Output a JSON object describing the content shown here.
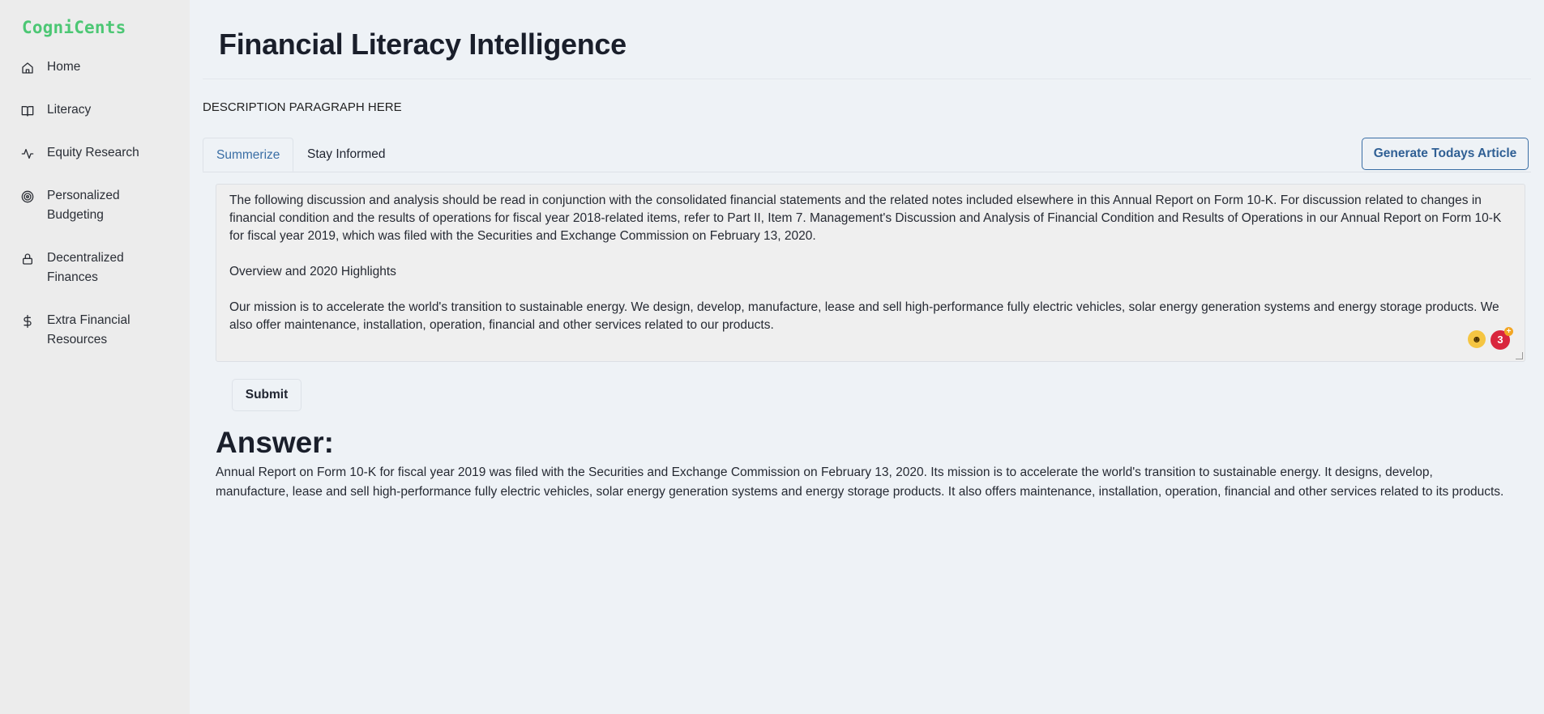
{
  "sidebar": {
    "brand": "CogniCents",
    "items": [
      {
        "label": "Home",
        "icon": "home-icon"
      },
      {
        "label": "Literacy",
        "icon": "book-icon"
      },
      {
        "label": "Equity Research",
        "icon": "activity-icon"
      },
      {
        "label": "Personalized Budgeting",
        "icon": "target-icon"
      },
      {
        "label": "Decentralized Finances",
        "icon": "lock-icon"
      },
      {
        "label": "Extra Financial Resources",
        "icon": "dollar-icon"
      }
    ]
  },
  "header": {
    "title": "Financial Literacy Intelligence"
  },
  "main": {
    "description": "DESCRIPTION PARAGRAPH HERE",
    "tabs": [
      {
        "label": "Summerize",
        "active": true
      },
      {
        "label": "Stay Informed",
        "active": false
      }
    ],
    "generate_button": "Generate Todays Article",
    "input": {
      "paragraph1": "The following discussion and analysis should be read in conjunction with the consolidated financial statements and the related notes included elsewhere in this Annual Report on Form 10-K. For discussion related to changes in financial condition and the results of operations for fiscal year 2018-related items, refer to Part II, Item 7. Management's Discussion and Analysis of Financial Condition and Results of Operations in our Annual Report on Form 10-K for fiscal year 2019, which was filed with the Securities and Exchange Commission on February 13, 2020.",
      "paragraph2": "Overview and 2020 Highlights",
      "paragraph3": "Our mission is to accelerate the world's transition to sustainable energy. We design, develop, manufacture, lease and sell high-performance fully electric vehicles, solar energy generation systems and energy storage products. We also offer maintenance, installation, operation, financial and other services related to our products.",
      "badge_count": "3"
    },
    "submit_label": "Submit",
    "answer_heading": "Answer:",
    "answer_text": "Annual Report on Form 10-K for fiscal year 2019 was filed with the Securities and Exchange Commission on February 13, 2020. Its mission is to accelerate the world's transition to sustainable energy. It designs, develop, manufacture, lease and sell high-performance fully electric vehicles, solar energy generation systems and energy storage products. It also offers maintenance, installation, operation, financial and other services related to its products."
  },
  "colors": {
    "brand": "#4cc774",
    "accent": "#3a6ea5",
    "background": "#eef2f6",
    "sidebar": "#ececec"
  }
}
